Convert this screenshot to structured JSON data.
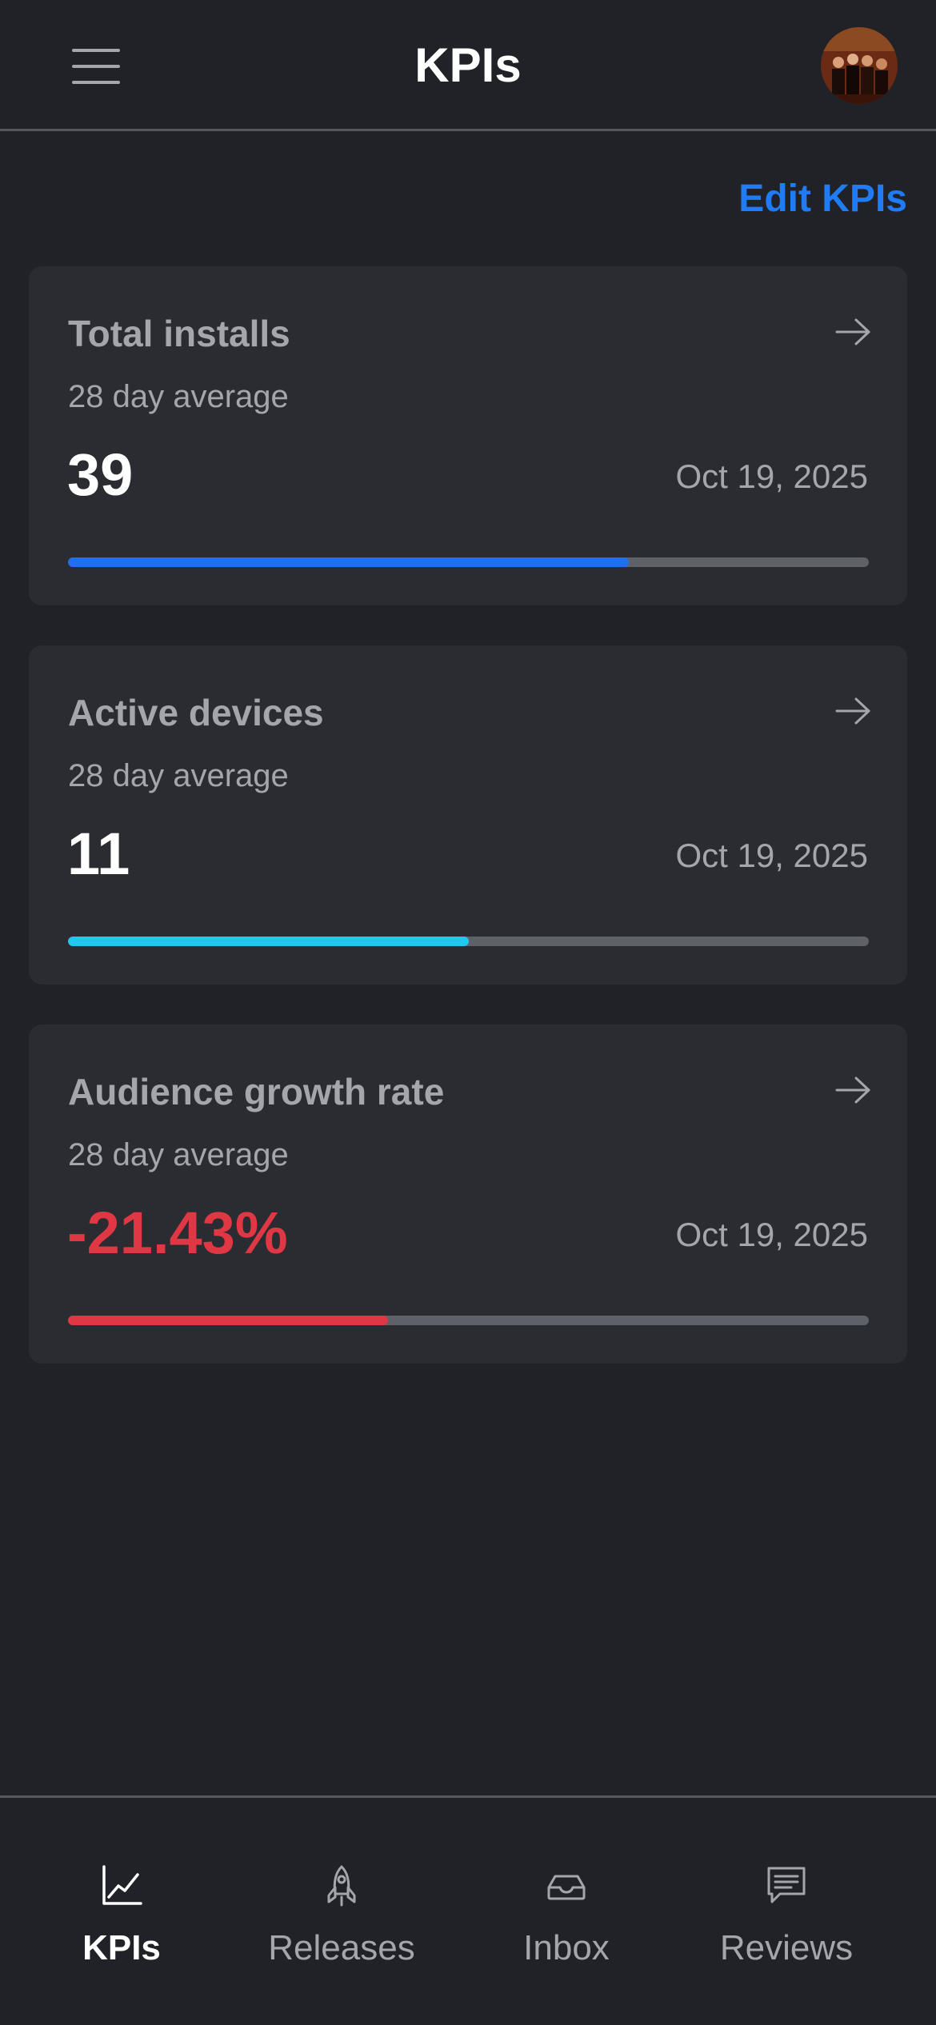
{
  "header": {
    "title": "KPIs",
    "menu_icon": "hamburger-menu-icon",
    "avatar_icon": "user-avatar"
  },
  "edit_link": "Edit KPIs",
  "colors": {
    "background": "#202228",
    "card": "#2a2c32",
    "accent_blue": "#1f7cf6",
    "accent_cyan": "#1ec8f0",
    "negative_red": "#e03744",
    "muted_text": "#a4a6ab"
  },
  "cards": [
    {
      "title": "Total installs",
      "subtitle": "28 day average",
      "value": "39",
      "date": "Oct 19, 2025",
      "progress_fraction": 0.7,
      "bar_color": "#1f6ff0",
      "negative": false
    },
    {
      "title": "Active devices",
      "subtitle": "28 day average",
      "value": "11",
      "date": "Oct 19, 2025",
      "progress_fraction": 0.5,
      "bar_color": "#1ec8f0",
      "negative": false
    },
    {
      "title": "Audience growth rate",
      "subtitle": "28 day average",
      "value": "-21.43%",
      "date": "Oct 19, 2025",
      "progress_fraction": 0.4,
      "bar_color": "#e03744",
      "negative": true
    }
  ],
  "bottom_nav": [
    {
      "label": "KPIs",
      "icon": "line-chart-icon",
      "active": true
    },
    {
      "label": "Releases",
      "icon": "rocket-icon",
      "active": false
    },
    {
      "label": "Inbox",
      "icon": "inbox-tray-icon",
      "active": false
    },
    {
      "label": "Reviews",
      "icon": "message-lines-icon",
      "active": false
    }
  ]
}
